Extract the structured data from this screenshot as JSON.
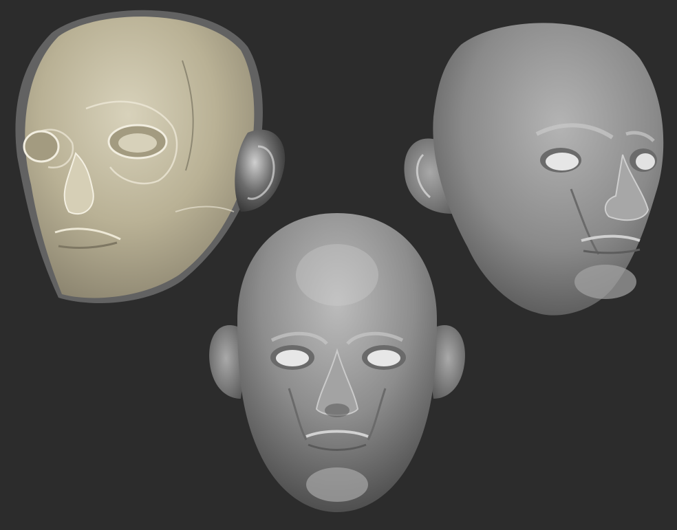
{
  "scene": {
    "background_color": "#2c2c2c",
    "subjects": [
      {
        "name": "transparent-skull-head-three-quarter",
        "material": "translucent-beige-over-skull",
        "skin_color": "#c9c2a8",
        "view": "three-quarter-left"
      },
      {
        "name": "clay-head-three-quarter-right",
        "material": "grey-matcap-clay",
        "skin_color": "#9a9a9a",
        "view": "three-quarter-right"
      },
      {
        "name": "clay-head-front",
        "material": "grey-matcap-clay",
        "skin_color": "#9c9c9c",
        "view": "front"
      }
    ]
  }
}
